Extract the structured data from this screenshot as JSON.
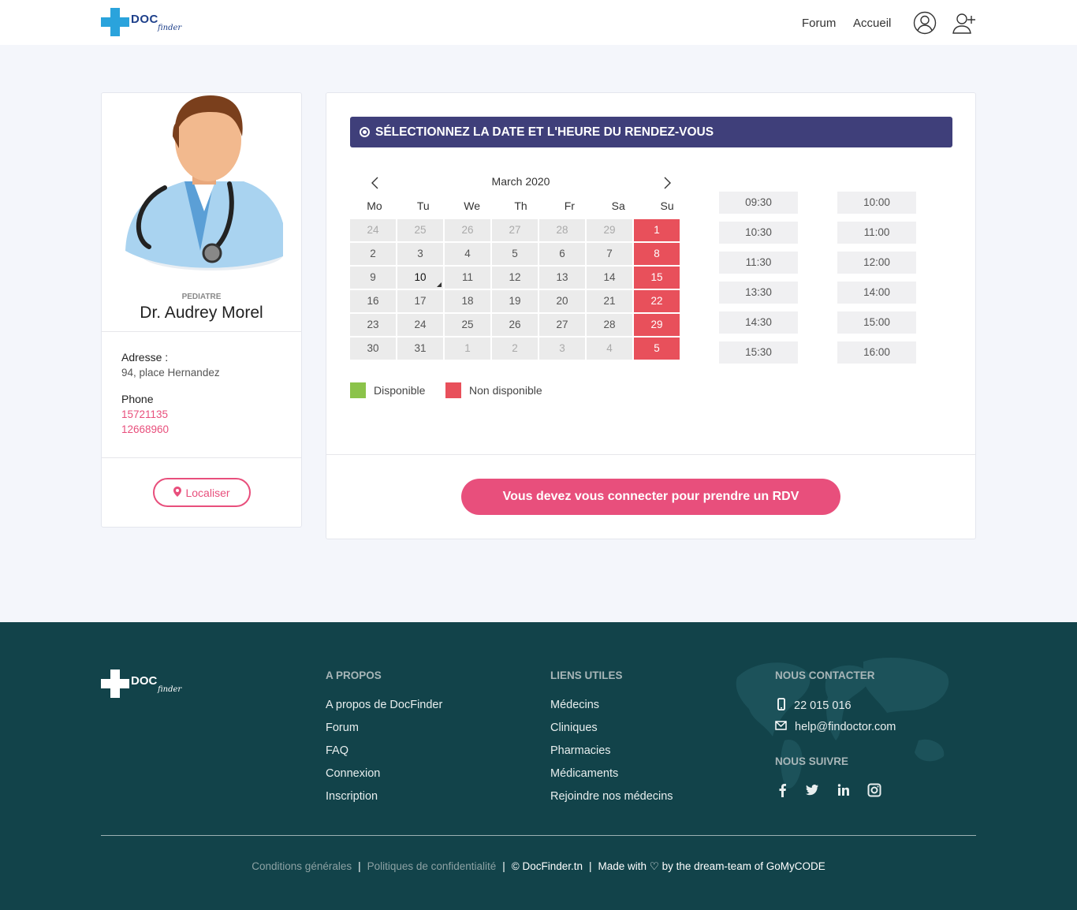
{
  "header": {
    "logo_doc": "DOC",
    "logo_finder": "finder",
    "nav": [
      {
        "label": "Forum"
      },
      {
        "label": "Accueil"
      }
    ],
    "icons": [
      "user-icon",
      "add-user-icon"
    ]
  },
  "doctor": {
    "specialty": "PEDIATRE",
    "name": "Dr. Audrey Morel",
    "address_label": "Adresse :",
    "address": "94, place Hernandez",
    "phone_label": "Phone",
    "phones": [
      "15721135",
      "12668960"
    ],
    "locate_label": "Localiser",
    "locate_icon": "map-pin-icon"
  },
  "booking": {
    "title": "SÉLECTIONNEZ LA DATE ET L'HEURE DU RENDEZ-VOUS",
    "calendar": {
      "month": "March 2020",
      "weekdays": [
        "Mo",
        "Tu",
        "We",
        "Th",
        "Fr",
        "Sa",
        "Su"
      ],
      "weeks": [
        [
          "24",
          "25",
          "26",
          "27",
          "28",
          "29",
          "1"
        ],
        [
          "2",
          "3",
          "4",
          "5",
          "6",
          "7",
          "8"
        ],
        [
          "9",
          "10",
          "11",
          "12",
          "13",
          "14",
          "15"
        ],
        [
          "16",
          "17",
          "18",
          "19",
          "20",
          "21",
          "22"
        ],
        [
          "23",
          "24",
          "25",
          "26",
          "27",
          "28",
          "29"
        ],
        [
          "30",
          "31",
          "1",
          "2",
          "3",
          "4",
          "5"
        ]
      ],
      "today": "10"
    },
    "slots_left": [
      "09:30",
      "10:30",
      "11:30",
      "13:30",
      "14:30",
      "15:30"
    ],
    "slots_right": [
      "10:00",
      "11:00",
      "12:00",
      "14:00",
      "15:00",
      "16:00"
    ],
    "legend": {
      "available": "Disponible",
      "unavailable": "Non disponible",
      "available_color": "#8bc34a",
      "unavailable_color": "#e8505b"
    },
    "cta": "Vous devez vous connecter pour prendre un RDV"
  },
  "colors": {
    "accent": "#e84f7c",
    "title_bar": "#3f3f7a",
    "footer_bg": "#12434a"
  },
  "footer": {
    "logo_doc": "DOC",
    "logo_finder": "finder",
    "about_title": "A PROPOS",
    "about_links": [
      "A propos de DocFinder",
      "Forum",
      "FAQ",
      "Connexion",
      "Inscription"
    ],
    "links_title": "LIENS UTILES",
    "useful_links": [
      "Médecins",
      "Cliniques",
      "Pharmacies",
      "Médicaments",
      "Rejoindre nos médecins"
    ],
    "contact_title": "NOUS CONTACTER",
    "phone": "22 015 016",
    "email": "help@findoctor.com",
    "follow_title": "NOUS SUIVRE",
    "social": [
      "facebook-icon",
      "twitter-icon",
      "linkedin-icon",
      "instagram-icon"
    ],
    "terms": "Conditions générales",
    "privacy": "Politiques de confidentialité",
    "copyright": "© DocFinder.tn",
    "made_with": "Made with ♡ by the dream-team of GoMyCODE"
  }
}
